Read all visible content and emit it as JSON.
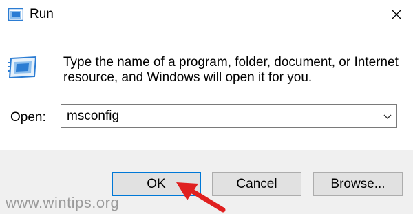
{
  "window": {
    "title": "Run",
    "close_icon": "close-icon",
    "app_icon": "run-app-icon"
  },
  "content": {
    "icon": "run-dialog-icon",
    "description_line1": "Type the name of a program, folder, document, or Internet",
    "description_line2": "resource, and Windows will open it for you."
  },
  "open_field": {
    "label": "Open:",
    "value": "msconfig",
    "dropdown_icon": "chevron-down-icon"
  },
  "buttons": {
    "ok": "OK",
    "cancel": "Cancel",
    "browse": "Browse..."
  },
  "watermark": "www.wintips.org",
  "colors": {
    "accent": "#0078d7",
    "annotation": "#e02020",
    "icon_blue": "#2b7cd3"
  }
}
